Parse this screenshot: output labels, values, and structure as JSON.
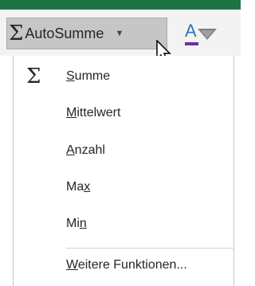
{
  "ribbon": {
    "accent_color": "#1e7145",
    "autosum_button": {
      "label": "AutoSumme",
      "icon": "sigma-icon",
      "dropdown_icon": "caret-down-icon"
    },
    "font_color_button": {
      "icon": "font-color-icon",
      "glyph": "A",
      "dropdown_icon": "triangle-down-icon"
    }
  },
  "menu": {
    "items": [
      {
        "pre": "",
        "u": "S",
        "post": "umme",
        "icon": "sigma-icon"
      },
      {
        "pre": "",
        "u": "M",
        "post": "ittelwert"
      },
      {
        "pre": "",
        "u": "A",
        "post": "nzahl"
      },
      {
        "pre": "Ma",
        "u": "x",
        "post": ""
      },
      {
        "pre": "Mi",
        "u": "n",
        "post": ""
      },
      {
        "pre": "",
        "u": "W",
        "post": "eitere Funktionen..."
      }
    ]
  }
}
